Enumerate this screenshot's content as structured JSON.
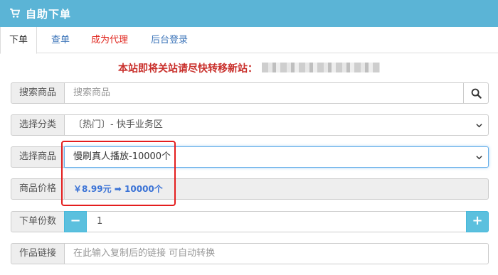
{
  "header": {
    "title": "自助下单"
  },
  "tabs": [
    {
      "label": "下单",
      "color": "#333333"
    },
    {
      "label": "查单",
      "color": "#3a73b8"
    },
    {
      "label": "成为代理",
      "color": "#e0231b"
    },
    {
      "label": "后台登录",
      "color": "#3a73b8"
    }
  ],
  "notice": "本站即将关站请尽快转移新站：",
  "search": {
    "label": "搜索商品",
    "placeholder": "搜索商品"
  },
  "category": {
    "label": "选择分类",
    "value": "〔热门〕- 快手业务区"
  },
  "product": {
    "label": "选择商品",
    "value": "慢刷真人播放-10000个"
  },
  "price": {
    "label": "商品价格",
    "value": "￥8.99元 ➡ 10000个"
  },
  "quantity": {
    "label": "下单份数",
    "value": "1",
    "minus": "−",
    "plus": "+"
  },
  "link": {
    "label": "作品链接",
    "placeholder": "在此输入复制后的链接 可自动转换"
  },
  "colors": {
    "header": "#5bb4d6",
    "accent": "#5bc0de",
    "notice": "#c9302c",
    "highlight": "#e41e1e"
  }
}
